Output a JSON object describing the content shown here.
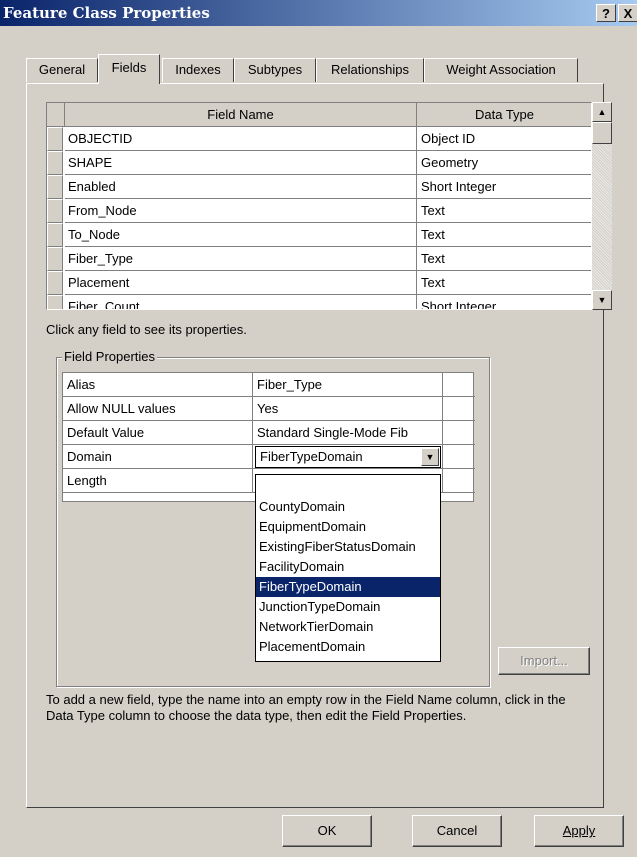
{
  "window": {
    "title": "Feature Class Properties",
    "help_glyph": "?",
    "close_glyph": "X"
  },
  "tabs": [
    {
      "label": "General"
    },
    {
      "label": "Fields",
      "active": true
    },
    {
      "label": "Indexes"
    },
    {
      "label": "Subtypes"
    },
    {
      "label": "Relationships"
    },
    {
      "label": "Weight Association"
    }
  ],
  "fields_grid": {
    "headers": {
      "name": "Field Name",
      "type": "Data Type"
    },
    "rows": [
      {
        "name": "OBJECTID",
        "type": "Object ID"
      },
      {
        "name": "SHAPE",
        "type": "Geometry"
      },
      {
        "name": "Enabled",
        "type": "Short Integer"
      },
      {
        "name": "From_Node",
        "type": "Text"
      },
      {
        "name": "To_Node",
        "type": "Text"
      },
      {
        "name": "Fiber_Type",
        "type": "Text"
      },
      {
        "name": "Placement",
        "type": "Text"
      },
      {
        "name": "Fiber_Count",
        "type": "Short Integer"
      }
    ]
  },
  "hint": "Click any field to see its properties.",
  "field_properties": {
    "group_label": "Field Properties",
    "rows": [
      {
        "name": "Alias",
        "value": "Fiber_Type"
      },
      {
        "name": "Allow NULL values",
        "value": "Yes"
      },
      {
        "name": "Default Value",
        "value": "Standard Single-Mode Fib"
      },
      {
        "name": "Domain",
        "value": "FiberTypeDomain"
      },
      {
        "name": "Length",
        "value": ""
      }
    ]
  },
  "domain_dropdown": {
    "selected": "FiberTypeDomain",
    "options": [
      "",
      "CountyDomain",
      "EquipmentDomain",
      "ExistingFiberStatusDomain",
      "FacilityDomain",
      "FiberTypeDomain",
      "JunctionTypeDomain",
      "NetworkTierDomain",
      "PlacementDomain"
    ]
  },
  "import_label": "Import...",
  "help_text": "To add a new field, type the name into an empty row in the Field Name column, click in the Data Type column to choose the data type, then edit the Field Properties.",
  "buttons": {
    "ok": "OK",
    "cancel": "Cancel",
    "apply": "Apply"
  }
}
